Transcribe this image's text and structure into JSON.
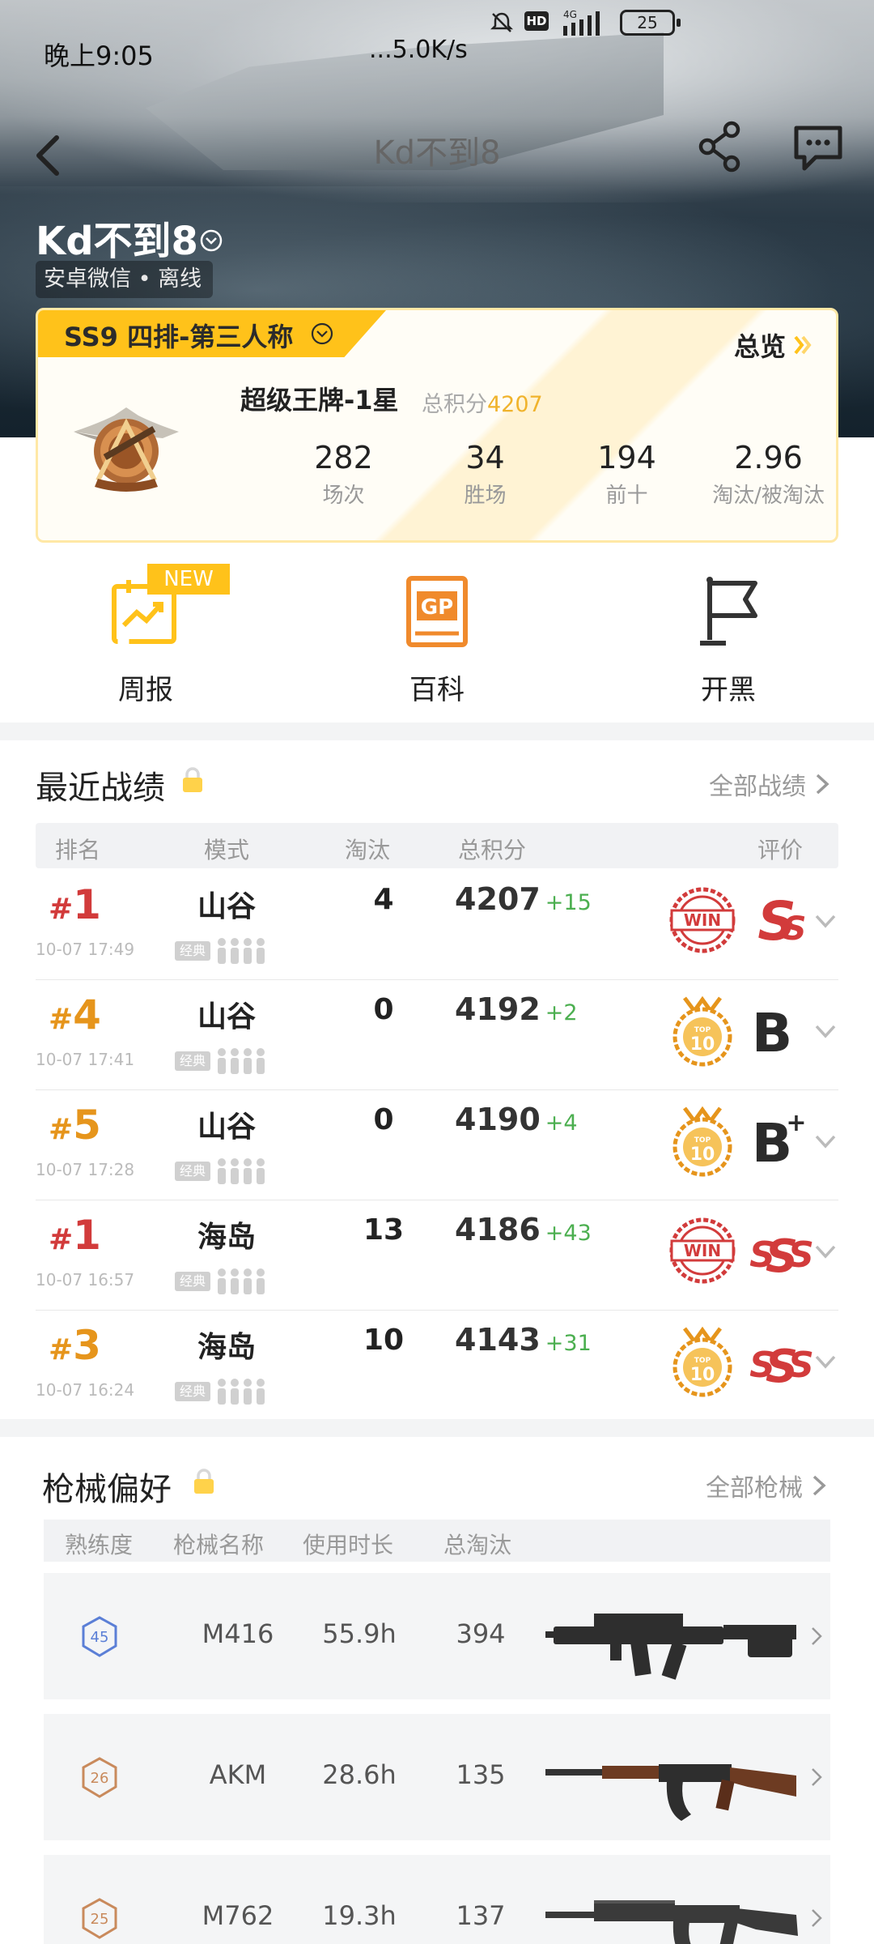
{
  "status_bar": {
    "time": "晚上9:05",
    "speed": "...5.0K/s",
    "hd": "HD",
    "network": "4G",
    "battery": "25"
  },
  "nav": {
    "title": "Kd不到8"
  },
  "profile": {
    "name": "Kd不到8",
    "subtitle": "安卓微信 • 离线"
  },
  "season": {
    "mode_label": "SS9 四排-第三人称",
    "overview_label": "总览",
    "rank_title": "超级王牌-1星",
    "points_label": "总积分",
    "points_value": "4207",
    "stats": [
      {
        "value": "282",
        "label": "场次"
      },
      {
        "value": "34",
        "label": "胜场"
      },
      {
        "value": "194",
        "label": "前十"
      },
      {
        "value": "2.96",
        "label": "淘汰/被淘汰"
      }
    ]
  },
  "quick_actions": [
    {
      "label": "周报",
      "badge": "NEW",
      "icon": "weekly-report-icon"
    },
    {
      "label": "百科",
      "badge": "",
      "icon": "gp-encyclopedia-icon"
    },
    {
      "label": "开黑",
      "badge": "",
      "icon": "flag-icon"
    }
  ],
  "recent": {
    "title": "最近战绩",
    "link": "全部战绩",
    "headers": {
      "rank": "排名",
      "mode": "模式",
      "kills": "淘汰",
      "score": "总积分",
      "rating": "评价"
    },
    "rows": [
      {
        "rank": "1",
        "time": "10-07 17:49",
        "map": "山谷",
        "tag": "经典",
        "kills": "4",
        "score": "4207",
        "delta": "+15",
        "badge": "win",
        "grade": "S",
        "rank_color": "#d23b3b"
      },
      {
        "rank": "4",
        "time": "10-07 17:41",
        "map": "山谷",
        "tag": "经典",
        "kills": "0",
        "score": "4192",
        "delta": "+2",
        "badge": "top10",
        "grade": "B",
        "rank_color": "#e6951c"
      },
      {
        "rank": "5",
        "time": "10-07 17:28",
        "map": "山谷",
        "tag": "经典",
        "kills": "0",
        "score": "4190",
        "delta": "+4",
        "badge": "top10",
        "grade": "B+",
        "rank_color": "#e6951c"
      },
      {
        "rank": "1",
        "time": "10-07 16:57",
        "map": "海岛",
        "tag": "经典",
        "kills": "13",
        "score": "4186",
        "delta": "+43",
        "badge": "win",
        "grade": "SSS",
        "rank_color": "#d23b3b"
      },
      {
        "rank": "3",
        "time": "10-07 16:24",
        "map": "海岛",
        "tag": "经典",
        "kills": "10",
        "score": "4143",
        "delta": "+31",
        "badge": "top10",
        "grade": "SSS",
        "rank_color": "#e6951c"
      }
    ]
  },
  "weapons": {
    "title": "枪械偏好",
    "link": "全部枪械",
    "headers": {
      "level": "熟练度",
      "name": "枪械名称",
      "time": "使用时长",
      "kills": "总淘汰"
    },
    "rows": [
      {
        "level": "45",
        "name": "M416",
        "time": "55.9h",
        "kills": "394",
        "level_color": "#5b7fd6"
      },
      {
        "level": "26",
        "name": "AKM",
        "time": "28.6h",
        "kills": "135",
        "level_color": "#c98a5c"
      },
      {
        "level": "25",
        "name": "M762",
        "time": "19.3h",
        "kills": "137",
        "level_color": "#c98a5c"
      }
    ]
  },
  "colors": {
    "accent": "#ffc21a",
    "win_red": "#d23b3b",
    "top10_gold": "#e6951c",
    "gain_green": "#4caf50"
  }
}
